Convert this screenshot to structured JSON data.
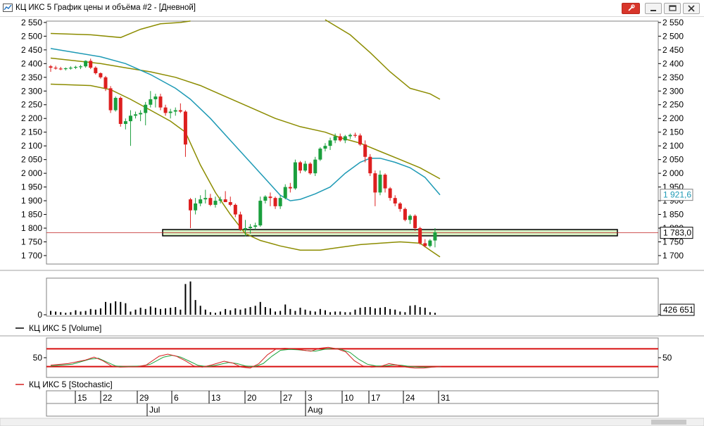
{
  "window": {
    "title": "КЦ ИКС 5 График цены и объёма #2 - [Дневной]",
    "icon": "chart-app-icon",
    "buttons": [
      "pin-icon",
      "minimize-icon",
      "restore-icon",
      "close-icon"
    ]
  },
  "colors": {
    "up": "#1a9f3d",
    "down": "#dd1f1f",
    "ma": "#1e9ab5",
    "band": "#8c8c00",
    "level_fill": "#d6f0c4",
    "stoch_k": "#d62020",
    "stoch_d": "#1aa33a",
    "stoch_level": "#d81010"
  },
  "chart_data": [
    {
      "type": "candlestick",
      "ylim": [
        1670,
        2560
      ],
      "y_ticks": [
        "2 550",
        "2 500",
        "2 450",
        "2 400",
        "2 350",
        "2 300",
        "2 250",
        "2 200",
        "2 150",
        "2 100",
        "2 050",
        "2 000",
        "1 950",
        "1 900",
        "1 850",
        "1 800",
        "1 750",
        "1 700"
      ],
      "y_tick_values": [
        2550,
        2500,
        2450,
        2400,
        2350,
        2300,
        2250,
        2200,
        2150,
        2100,
        2050,
        2000,
        1950,
        1900,
        1850,
        1800,
        1750,
        1700
      ],
      "price_label": "1 783,0",
      "price_value": 1783,
      "ma_label": "1 921,6",
      "ma_value": 1921.6,
      "support_zone": [
        1772,
        1795
      ],
      "candles": [
        [
          2390,
          2395,
          2370,
          2385
        ],
        [
          2385,
          2392,
          2378,
          2382
        ],
        [
          2382,
          2388,
          2376,
          2380
        ],
        [
          2380,
          2386,
          2375,
          2383
        ],
        [
          2383,
          2390,
          2378,
          2385
        ],
        [
          2385,
          2392,
          2380,
          2388
        ],
        [
          2388,
          2395,
          2380,
          2390
        ],
        [
          2390,
          2412,
          2385,
          2410
        ],
        [
          2410,
          2418,
          2380,
          2385
        ],
        [
          2385,
          2390,
          2360,
          2365
        ],
        [
          2365,
          2368,
          2345,
          2350
        ],
        [
          2350,
          2355,
          2300,
          2310
        ],
        [
          2310,
          2318,
          2220,
          2230
        ],
        [
          2230,
          2280,
          2225,
          2275
        ],
        [
          2275,
          2280,
          2170,
          2180
        ],
        [
          2180,
          2200,
          2160,
          2190
        ],
        [
          2190,
          2230,
          2100,
          2210
        ],
        [
          2210,
          2225,
          2200,
          2215
        ],
        [
          2215,
          2230,
          2190,
          2220
        ],
        [
          2220,
          2260,
          2175,
          2250
        ],
        [
          2250,
          2300,
          2240,
          2270
        ],
        [
          2270,
          2290,
          2240,
          2280
        ],
        [
          2280,
          2290,
          2230,
          2240
        ],
        [
          2240,
          2250,
          2210,
          2220
        ],
        [
          2220,
          2235,
          2200,
          2225
        ],
        [
          2225,
          2240,
          2210,
          2230
        ],
        [
          2230,
          2255,
          2220,
          2225
        ],
        [
          2225,
          2230,
          2060,
          2105
        ],
        [
          1905,
          1910,
          1800,
          1865
        ],
        [
          1865,
          1910,
          1850,
          1890
        ],
        [
          1890,
          1920,
          1880,
          1905
        ],
        [
          1905,
          1940,
          1890,
          1910
        ],
        [
          1910,
          1925,
          1880,
          1885
        ],
        [
          1885,
          1915,
          1875,
          1900
        ],
        [
          1900,
          1915,
          1890,
          1905
        ],
        [
          1905,
          1935,
          1895,
          1895
        ],
        [
          1895,
          1915,
          1880,
          1885
        ],
        [
          1885,
          1890,
          1840,
          1850
        ],
        [
          1850,
          1860,
          1790,
          1795
        ],
        [
          1795,
          1830,
          1770,
          1800
        ],
        [
          1800,
          1815,
          1780,
          1805
        ],
        [
          1805,
          1820,
          1795,
          1810
        ],
        [
          1810,
          1915,
          1805,
          1900
        ],
        [
          1900,
          1920,
          1890,
          1915
        ],
        [
          1915,
          1930,
          1880,
          1910
        ],
        [
          1910,
          1915,
          1870,
          1880
        ],
        [
          1880,
          1920,
          1870,
          1910
        ],
        [
          1910,
          1960,
          1905,
          1950
        ],
        [
          1950,
          1965,
          1930,
          1945
        ],
        [
          1945,
          2050,
          1940,
          2040
        ],
        [
          2040,
          2045,
          2000,
          2010
        ],
        [
          2010,
          2045,
          2005,
          2035
        ],
        [
          2035,
          2040,
          1995,
          2000
        ],
        [
          2000,
          2060,
          1990,
          2050
        ],
        [
          2050,
          2095,
          2045,
          2090
        ],
        [
          2090,
          2110,
          2080,
          2100
        ],
        [
          2100,
          2130,
          2085,
          2120
        ],
        [
          2120,
          2145,
          2110,
          2135
        ],
        [
          2135,
          2145,
          2115,
          2120
        ],
        [
          2120,
          2140,
          2110,
          2135
        ],
        [
          2135,
          2145,
          2125,
          2140
        ],
        [
          2140,
          2148,
          2130,
          2138
        ],
        [
          2138,
          2145,
          2100,
          2105
        ],
        [
          2105,
          2120,
          2040,
          2060
        ],
        [
          2060,
          2070,
          1990,
          2000
        ],
        [
          2000,
          2010,
          1880,
          1930
        ],
        [
          1930,
          2010,
          1920,
          1995
        ],
        [
          1995,
          2000,
          1930,
          1945
        ],
        [
          1945,
          1950,
          1900,
          1910
        ],
        [
          1910,
          1920,
          1880,
          1890
        ],
        [
          1890,
          1895,
          1860,
          1870
        ],
        [
          1870,
          1875,
          1825,
          1830
        ],
        [
          1830,
          1850,
          1815,
          1845
        ],
        [
          1845,
          1850,
          1790,
          1800
        ],
        [
          1800,
          1805,
          1740,
          1745
        ],
        [
          1745,
          1760,
          1730,
          1735
        ],
        [
          1735,
          1760,
          1730,
          1755
        ],
        [
          1755,
          1800,
          1730,
          1785
        ]
      ],
      "ma_line": [
        [
          0,
          2455
        ],
        [
          5,
          2440
        ],
        [
          10,
          2425
        ],
        [
          15,
          2400
        ],
        [
          20,
          2360
        ],
        [
          25,
          2310
        ],
        [
          28,
          2270
        ],
        [
          32,
          2200
        ],
        [
          36,
          2120
        ],
        [
          40,
          2040
        ],
        [
          44,
          1960
        ],
        [
          46,
          1920
        ],
        [
          48,
          1900
        ],
        [
          50,
          1905
        ],
        [
          53,
          1925
        ],
        [
          56,
          1950
        ],
        [
          59,
          2000
        ],
        [
          62,
          2040
        ],
        [
          64,
          2055
        ],
        [
          66,
          2055
        ],
        [
          69,
          2040
        ],
        [
          72,
          2020
        ],
        [
          75,
          1985
        ],
        [
          78,
          1921.6
        ]
      ],
      "upper_band": [
        [
          0,
          2510
        ],
        [
          8,
          2505
        ],
        [
          14,
          2495
        ],
        [
          18,
          2525
        ],
        [
          22,
          2545
        ],
        [
          26,
          2550
        ],
        [
          28,
          2555
        ]
      ],
      "upper_band_2": [
        [
          55,
          2560
        ],
        [
          60,
          2505
        ],
        [
          64,
          2440
        ],
        [
          68,
          2370
        ],
        [
          72,
          2310
        ],
        [
          76,
          2290
        ],
        [
          78,
          2270
        ]
      ],
      "middle_band": [
        [
          0,
          2420
        ],
        [
          5,
          2410
        ],
        [
          10,
          2400
        ],
        [
          15,
          2385
        ],
        [
          20,
          2370
        ],
        [
          25,
          2350
        ],
        [
          30,
          2320
        ],
        [
          35,
          2280
        ],
        [
          40,
          2240
        ],
        [
          45,
          2200
        ],
        [
          50,
          2170
        ],
        [
          55,
          2150
        ],
        [
          58,
          2130
        ],
        [
          62,
          2110
        ],
        [
          66,
          2080
        ],
        [
          70,
          2050
        ],
        [
          74,
          2020
        ],
        [
          78,
          1980
        ]
      ],
      "lower_band": [
        [
          0,
          2325
        ],
        [
          8,
          2320
        ],
        [
          12,
          2305
        ],
        [
          16,
          2270
        ],
        [
          20,
          2230
        ],
        [
          24,
          2190
        ],
        [
          27,
          2150
        ],
        [
          30,
          2030
        ],
        [
          33,
          1930
        ],
        [
          36,
          1850
        ],
        [
          39,
          1780
        ],
        [
          42,
          1755
        ],
        [
          46,
          1735
        ],
        [
          50,
          1720
        ],
        [
          54,
          1720
        ],
        [
          58,
          1730
        ],
        [
          62,
          1740
        ],
        [
          66,
          1745
        ],
        [
          70,
          1750
        ],
        [
          74,
          1745
        ],
        [
          76,
          1720
        ],
        [
          78,
          1695
        ]
      ]
    },
    {
      "type": "bar",
      "series": [
        {
          "name": "КЦ ИКС 5 [Volume]",
          "values": [
            6,
            5,
            4,
            3,
            4,
            7,
            5,
            6,
            9,
            8,
            10,
            20,
            18,
            21,
            20,
            18,
            5,
            8,
            11,
            9,
            13,
            11,
            9,
            10,
            11,
            12,
            8,
            48,
            52,
            23,
            14,
            8,
            4,
            3,
            5,
            9,
            7,
            10,
            8,
            10,
            12,
            14,
            20,
            12,
            10,
            5,
            6,
            16,
            9,
            6,
            11,
            8,
            6,
            5,
            9,
            7,
            4,
            5,
            5,
            4,
            4,
            8,
            11,
            12,
            12,
            10,
            11,
            12,
            9,
            8,
            5,
            4,
            14,
            15,
            12,
            11,
            4,
            3
          ]
        }
      ],
      "value_label": "426 651",
      "tick_label": "0"
    },
    {
      "type": "line",
      "series": [
        {
          "name": "КЦ ИКС 5 [Stochastic]",
          "values": [
            [
              0,
              25
            ],
            [
              4,
              30
            ],
            [
              8,
              42
            ],
            [
              10,
              52
            ],
            [
              12,
              40
            ],
            [
              14,
              22
            ],
            [
              16,
              18
            ],
            [
              20,
              20
            ],
            [
              22,
              25
            ],
            [
              25,
              55
            ],
            [
              27,
              62
            ],
            [
              29,
              55
            ],
            [
              31,
              40
            ],
            [
              33,
              22
            ],
            [
              35,
              18
            ],
            [
              37,
              25
            ],
            [
              40,
              38
            ],
            [
              42,
              32
            ],
            [
              44,
              18
            ],
            [
              46,
              15
            ],
            [
              48,
              30
            ],
            [
              50,
              60
            ],
            [
              52,
              80
            ],
            [
              54,
              82
            ],
            [
              56,
              80
            ],
            [
              58,
              76
            ],
            [
              60,
              72
            ],
            [
              62,
              82
            ],
            [
              64,
              85
            ],
            [
              66,
              80
            ],
            [
              68,
              70
            ],
            [
              70,
              40
            ],
            [
              72,
              22
            ],
            [
              74,
              18
            ],
            [
              76,
              20
            ],
            [
              78,
              30
            ],
            [
              80,
              25
            ],
            [
              82,
              18
            ],
            [
              84,
              15
            ],
            [
              86,
              15
            ],
            [
              88,
              18
            ],
            [
              90,
              20
            ]
          ]
        },
        {
          "name": "",
          "values": [
            [
              0,
              22
            ],
            [
              5,
              28
            ],
            [
              9,
              45
            ],
            [
              11,
              48
            ],
            [
              13,
              35
            ],
            [
              15,
              22
            ],
            [
              17,
              20
            ],
            [
              21,
              22
            ],
            [
              23,
              28
            ],
            [
              26,
              52
            ],
            [
              28,
              58
            ],
            [
              30,
              52
            ],
            [
              32,
              38
            ],
            [
              34,
              24
            ],
            [
              36,
              20
            ],
            [
              38,
              24
            ],
            [
              41,
              34
            ],
            [
              43,
              30
            ],
            [
              45,
              22
            ],
            [
              47,
              20
            ],
            [
              49,
              30
            ],
            [
              51,
              55
            ],
            [
              53,
              75
            ],
            [
              55,
              78
            ],
            [
              57,
              77
            ],
            [
              59,
              74
            ],
            [
              61,
              72
            ],
            [
              63,
              78
            ],
            [
              65,
              82
            ],
            [
              67,
              78
            ],
            [
              69,
              68
            ],
            [
              71,
              45
            ],
            [
              73,
              28
            ],
            [
              75,
              22
            ],
            [
              77,
              22
            ],
            [
              79,
              26
            ],
            [
              81,
              24
            ],
            [
              83,
              20
            ],
            [
              85,
              18
            ],
            [
              87,
              18
            ],
            [
              89,
              19
            ],
            [
              90,
              20
            ]
          ]
        }
      ],
      "levels": [
        80,
        20
      ],
      "tick_label": "50"
    }
  ],
  "x_axis": {
    "day_labels": [
      "15",
      "22",
      "29",
      "6",
      "13",
      "20",
      "27",
      "3",
      "10",
      "17",
      "24",
      "31"
    ],
    "month_labels": [
      "Jul",
      "Aug"
    ]
  }
}
